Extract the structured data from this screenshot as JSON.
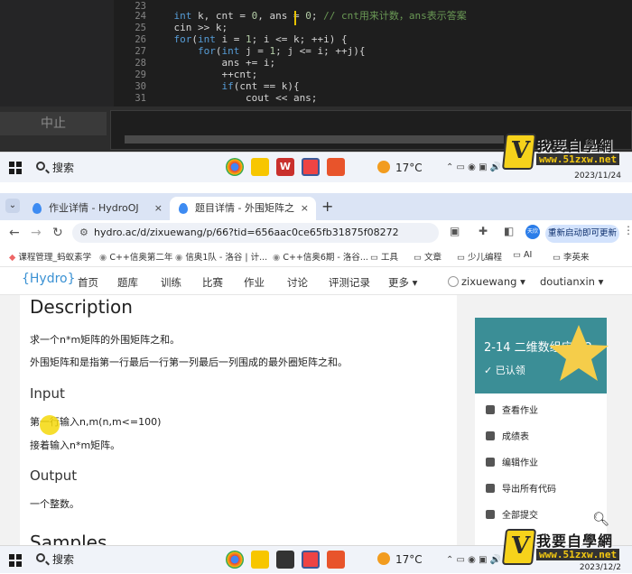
{
  "ide": {
    "panel_button": "中止",
    "line_numbers": [
      "23",
      "24",
      "25",
      "26",
      "27",
      "28",
      "29",
      "30",
      "31"
    ],
    "code_lines": [
      "",
      "    int k, cnt = 0, ans = 0; // cnt用来计数，ans表示答案",
      "    cin >> k;",
      "    for(int i = 1; i <= k; ++i) {",
      "        for(int j = 1; j <= i; ++j){",
      "            ans += i;",
      "            ++cnt;",
      "            if(cnt == k){",
      "                cout << ans;"
    ]
  },
  "taskbar_top": {
    "search": "搜索",
    "weather": "17°C",
    "time": "",
    "date": "2023/11/24"
  },
  "taskbar_bottom": {
    "search": "搜索",
    "weather": "17°C",
    "time": "",
    "date": "2023/12/2"
  },
  "watermark": {
    "title": "我要自學網",
    "url": "www.51zxw.net"
  },
  "browser": {
    "tabs": [
      {
        "label": "作业详情 - HydroOJ",
        "close": "×"
      },
      {
        "label": "题目详情 - 外围矩阵之和 - Hyd",
        "close": "×"
      }
    ],
    "new_tab": "+",
    "url": "hydro.ac/d/zixuewang/p/66?tid=656aac0ce65fb31875f08272",
    "restart_button": "重新启动即可更新",
    "profile": "天欣",
    "bookmarks": [
      "课程管理_蚂蚁素学",
      "C++信奥第二年",
      "信奥1队 - 洛谷 | 计...",
      "C++信奥6期 - 洛谷...",
      "工具",
      "文章",
      "少儿编程",
      "AI",
      "李英来"
    ]
  },
  "site": {
    "logo": "{Hydro}",
    "nav": [
      "首页",
      "题库",
      "训练",
      "比赛",
      "作业",
      "讨论",
      "评测记录",
      "更多"
    ],
    "user1": "zixuewang",
    "user2": "doutianxin"
  },
  "problem": {
    "description_heading": "Description",
    "desc1": "求一个n*m矩阵的外围矩阵之和。",
    "desc2": "外围矩阵和是指第一行最后一行第一列最后一列围成的最外圈矩阵之和。",
    "input_heading": "Input",
    "input1": "第一行输入n,m(n,m<=100)",
    "input2": "接着输入n*m矩阵。",
    "output_heading": "Output",
    "output1": "一个整数。",
    "samples_heading": "Samples"
  },
  "sidebar": {
    "title": "2-14 二维数组应用2",
    "status": "✓ 已认领",
    "items": [
      "查看作业",
      "成绩表",
      "编辑作业",
      "导出所有代码",
      "全部提交"
    ]
  }
}
